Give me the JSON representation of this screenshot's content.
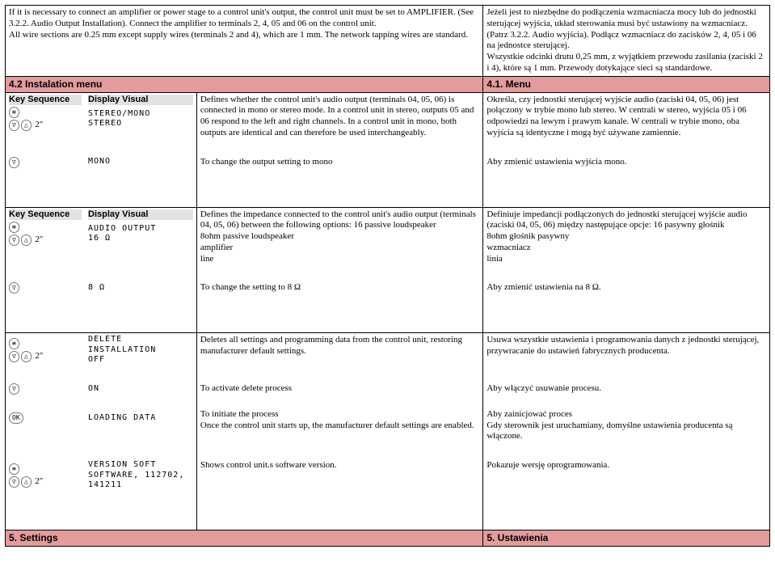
{
  "intro": {
    "en": "If it is necessary to connect an amplifier or power stage to a control unit's output, the control unit must be set to AMPLIFIER. (See 3.2.2. Audio Output Installation). Connect the amplifier to terminals 2, 4, 05 and 06 on the control unit.\nAll wire sections are 0.25 mm except supply wires (terminals 2 and 4), which are 1 mm. The network tapping wires are standard.",
    "pl": "Jeżeli jest to niezbędne do podłączenia wzmacniacza mocy lub do jednostki sterującej wyjścia, układ sterowania musi być ustawiony na wzmacniacz. (Patrz 3.2.2. Audio wyjścia). Podłącz wzmacniacz do zacisków 2, 4, 05 i 06 na jednostce sterującej.\nWszystkie odcinki drutu 0,25 mm, z wyjątkiem przewodu zasilania (zaciski 2 i 4), które są 1 mm. Przewody dotykające sieci są standardowe."
  },
  "sections": {
    "install_en": "4.2 Instalation menu",
    "install_pl": "4.1. Menu",
    "settings_en": "5. Settings",
    "settings_pl": "5. Ustawienia"
  },
  "headers": {
    "key": "Key Sequence",
    "visual": "Display Visual"
  },
  "visuals": {
    "stereo_mono": "STEREO/MONO\nSTEREO",
    "mono": "MONO",
    "audio16": "AUDIO OUTPUT\n16 Ω",
    "ohm8": "8 Ω",
    "delete_off": "DELETE INSTALLATION\nOFF",
    "on": "ON",
    "loading": "LOADING DATA",
    "version": "VERSION SOFT\nSOFTWARE, 112702, 141211"
  },
  "rows": {
    "r1": {
      "en": "Defines whether the control unit's audio output (terminals 04, 05, 06) is connected in mono or stereo mode. In a control unit in stereo, outputs 05 and 06 respond to the left and right channels. In a control unit in mono, both outputs are identical and can therefore be used interchangeably.",
      "pl": "Określa, czy jednostki sterującej wyjście audio (zaciski 04, 05, 06) jest połączony w trybie mono lub stereo. W centrali w stereo, wyjścia 05 i 06 odpowiedzi na lewym i prawym kanale. W centrali w trybie mono, oba wyjścia są identyczne i mogą być używane zamiennie."
    },
    "r2": {
      "en": "To change the output setting to mono",
      "pl": "Aby zmienić ustawienia wyjścia mono."
    },
    "r3": {
      "en": "Defines the impedance connected to the control unit's audio output (terminals 04, 05, 06) between the following options: 16 passive loudspeaker\n8ohm passive loudspeaker\namplifier\nline",
      "pl": "Definiuje impedancji podłączonych do jednostki sterującej wyjście audio (zaciski 04, 05, 06) między następujące opcje: 16 pasywny głośnik\n8ohm głośnik pasywny\nwzmacniacz\nlinia"
    },
    "r4": {
      "en": "To change the setting to 8 Ω",
      "pl": "Aby zmienić ustawienia na 8 Ω."
    },
    "r5": {
      "en": "Deletes all settings and programming data from the control unit, restoring manufacturer default settings.",
      "pl": "Usuwa wszystkie ustawienia i programowania danych z jednostki sterującej, przywracanie do ustawień fabrycznych producenta."
    },
    "r6": {
      "en": "To activate delete process",
      "pl": "Aby włączyć usuwanie procesu."
    },
    "r7": {
      "en": "To initiate the process\nOnce the control unit starts up, the manufacturer default settings are enabled.",
      "pl": "Aby zainicjować proces\nGdy sterownik jest uruchamiany, domyślne ustawienia producenta są włączone."
    },
    "r8": {
      "en": "Shows control unit.s software version.",
      "pl": "Pokazuje wersję oprogramowania."
    }
  }
}
